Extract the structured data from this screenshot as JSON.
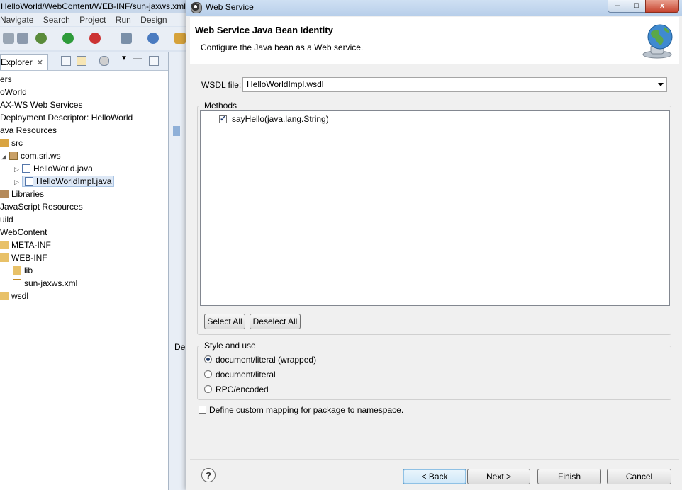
{
  "eclipse": {
    "title": "HelloWorld/WebContent/WEB-INF/sun-jaxws.xml",
    "menu": [
      "Navigate",
      "Search",
      "Project",
      "Run",
      "Design"
    ],
    "explorer_tab": "Explorer",
    "tree": [
      {
        "label": "ers"
      },
      {
        "label": "oWorld"
      },
      {
        "label": "AX-WS Web Services"
      },
      {
        "label": "Deployment Descriptor: HelloWorld"
      },
      {
        "label": "ava Resources"
      },
      {
        "label": "src"
      },
      {
        "label": "com.sri.ws"
      },
      {
        "label": "HelloWorld.java"
      },
      {
        "label": "HelloWorldImpl.java"
      },
      {
        "label": "Libraries"
      },
      {
        "label": "JavaScript Resources"
      },
      {
        "label": "uild"
      },
      {
        "label": "WebContent"
      },
      {
        "label": "META-INF"
      },
      {
        "label": "WEB-INF"
      },
      {
        "label": "lib"
      },
      {
        "label": "sun-jaxws.xml"
      },
      {
        "label": "wsdl"
      }
    ],
    "editor_tab_fragment": "De"
  },
  "dialog": {
    "window_title": "Web Service",
    "header_title": "Web Service Java Bean Identity",
    "header_description": "Configure the Java bean as a Web service.",
    "wsdl_label": "WSDL file:",
    "wsdl_value": "HelloWorldImpl.wsdl",
    "methods_label": "Methods",
    "methods": [
      {
        "label": "sayHello(java.lang.String)",
        "checked": true
      }
    ],
    "select_all": "Select All",
    "deselect_all": "Deselect All",
    "style_label": "Style and use",
    "style_options": [
      {
        "label": "document/literal (wrapped)",
        "selected": true
      },
      {
        "label": "document/literal",
        "selected": false
      },
      {
        "label": "RPC/encoded",
        "selected": false
      }
    ],
    "custom_mapping_label": "Define custom mapping for package to namespace.",
    "custom_mapping_checked": false,
    "help": "?",
    "back": "< Back",
    "next": "Next >",
    "finish": "Finish",
    "cancel": "Cancel",
    "minimize": "–",
    "maximize": "□",
    "close": "x"
  }
}
